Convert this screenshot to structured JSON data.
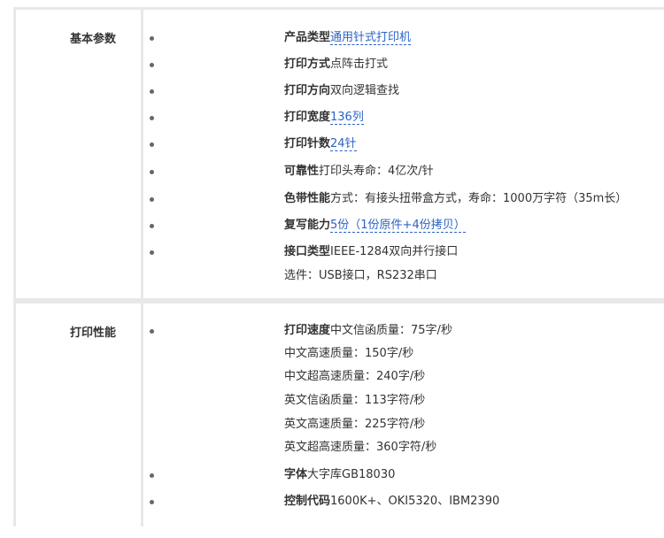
{
  "basic": {
    "label": "基本参数",
    "rows": [
      {
        "key": "产品类型",
        "value": "通用针式打印机"
      },
      {
        "key": "打印方式",
        "value": "点阵击打式"
      },
      {
        "key": "打印方向",
        "value": "双向逻辑查找"
      },
      {
        "key": "打印宽度",
        "value": "136列"
      },
      {
        "key": "打印针数",
        "value": "24针"
      },
      {
        "key": "可靠性",
        "value": "打印头寿命：4亿次/针"
      },
      {
        "key": "色带性能",
        "value": "方式：有接头扭带盒方式，寿命：1000万字符（35m长）"
      },
      {
        "key": "复写能力",
        "value": "5份（1份原件+4份拷贝）"
      },
      {
        "key": "接口类型",
        "value": "IEEE-1284双向并行接口"
      },
      {
        "extra": "选件：USB接口，RS232串口"
      }
    ]
  },
  "performance": {
    "label": "打印性能",
    "rows": [
      {
        "key": "打印速度",
        "value": "中文信函质量：75字/秒"
      },
      {
        "extra": "中文高速质量：150字/秒"
      },
      {
        "extra": "中文超高速质量：240字/秒"
      },
      {
        "extra": "英文信函质量：113字符/秒"
      },
      {
        "extra": "英文高速质量：225字符/秒"
      },
      {
        "extra": "英文超高速质量：360字符/秒"
      },
      {
        "key": "字体",
        "value": "大字库GB18030"
      },
      {
        "key": "控制代码",
        "value": "1600K+、OKI5320、IBM2390"
      }
    ]
  }
}
